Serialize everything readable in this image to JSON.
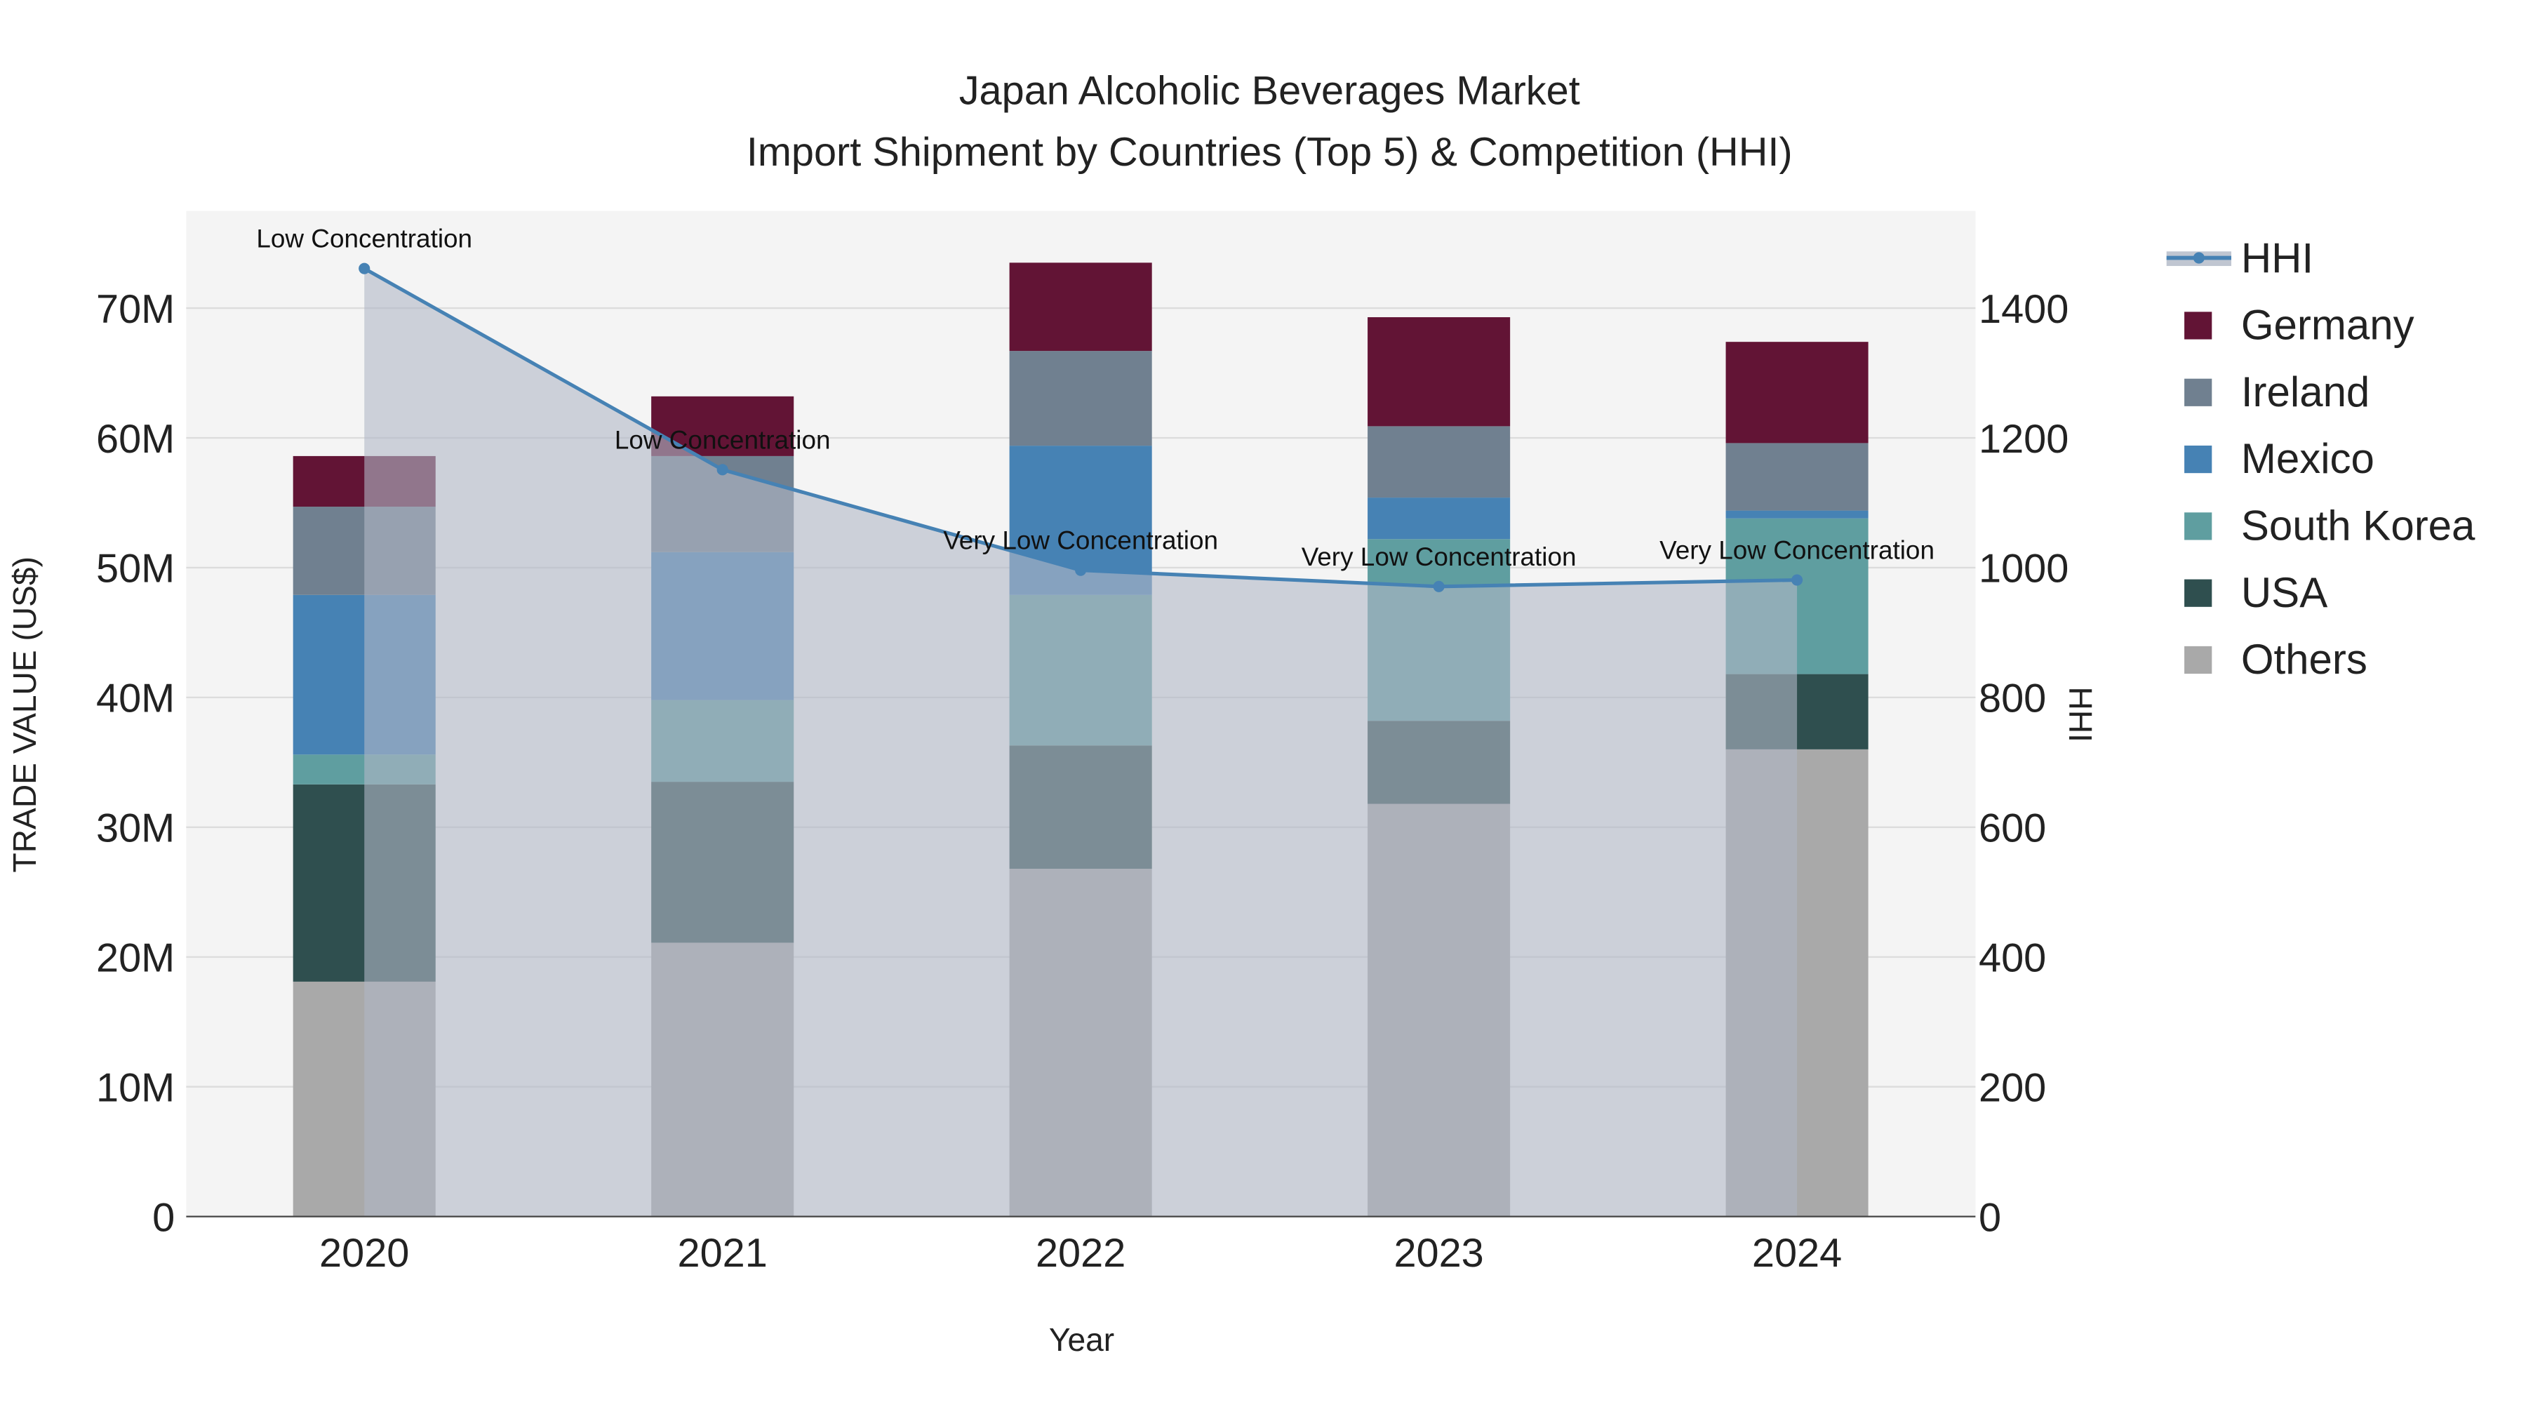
{
  "chart_data": {
    "type": "bar",
    "title": "Japan Alcoholic Beverages Market",
    "subtitle": "Import Shipment by Countries (Top 5) & Competition (HHI)",
    "xlabel": "Year",
    "ylabel": "TRADE VALUE (US$)",
    "y2label": "HHI",
    "categories": [
      "2020",
      "2021",
      "2022",
      "2023",
      "2024"
    ],
    "ylim": [
      0,
      77
    ],
    "y2lim": [
      0,
      1540
    ],
    "yticks": [
      0,
      10,
      20,
      30,
      40,
      50,
      60,
      70
    ],
    "ytick_labels": [
      "0",
      "10M",
      "20M",
      "30M",
      "40M",
      "50M",
      "60M",
      "70M"
    ],
    "y2ticks": [
      0,
      200,
      400,
      600,
      800,
      1000,
      1200,
      1400
    ],
    "y2tick_labels": [
      "0",
      "200",
      "400",
      "600",
      "800",
      "1000",
      "1200",
      "1400"
    ],
    "units": "millions US$",
    "stacked": true,
    "series": [
      {
        "name": "Others",
        "color": "#A9A9A9",
        "values": [
          18.1,
          21.1,
          26.8,
          31.8,
          36.0
        ]
      },
      {
        "name": "USA",
        "color": "#2F4F4F",
        "values": [
          15.2,
          12.4,
          9.5,
          6.4,
          5.8
        ]
      },
      {
        "name": "South Korea",
        "color": "#5F9EA0",
        "values": [
          2.3,
          6.3,
          11.6,
          14.0,
          12.0
        ]
      },
      {
        "name": "Mexico",
        "color": "#4682B4",
        "values": [
          12.3,
          11.4,
          11.5,
          3.2,
          0.6
        ]
      },
      {
        "name": "Ireland",
        "color": "#708090",
        "values": [
          6.8,
          7.4,
          7.3,
          5.5,
          5.2
        ]
      },
      {
        "name": "Germany",
        "color": "#621435",
        "values": [
          3.9,
          4.6,
          6.8,
          8.4,
          7.8
        ]
      }
    ],
    "hhi": {
      "name": "HHI",
      "color": "#4682B4",
      "values": [
        1461,
        1151,
        996,
        971,
        981
      ],
      "annotations": [
        "Low Concentration",
        "Low Concentration",
        "Very Low Concentration",
        "Very Low Concentration",
        "Very Low Concentration"
      ]
    },
    "legend_order": [
      "HHI",
      "Germany",
      "Ireland",
      "Mexico",
      "South Korea",
      "USA",
      "Others"
    ],
    "legend_position": "right",
    "grid": true
  }
}
